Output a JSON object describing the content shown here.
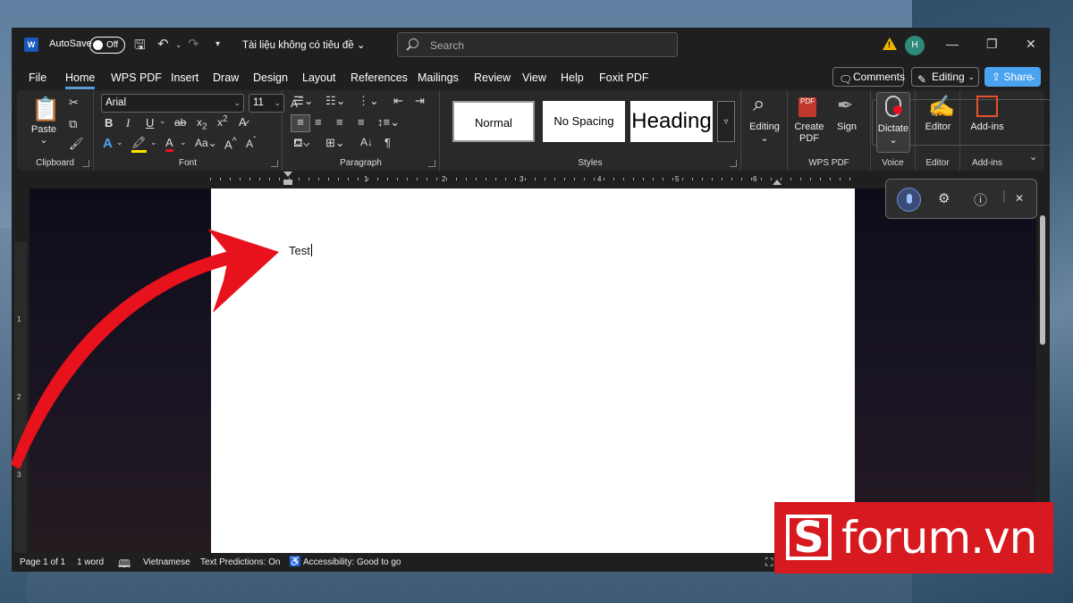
{
  "titlebar": {
    "app_badge": "W",
    "autosave_label": "AutoSave",
    "autosave_state": "Off",
    "document_title": "Tài liệu không có tiêu đề",
    "search_placeholder": "Search",
    "user_initial": "H"
  },
  "menu": {
    "tabs": [
      "File",
      "Home",
      "WPS PDF",
      "Insert",
      "Draw",
      "Design",
      "Layout",
      "References",
      "Mailings",
      "Review",
      "View",
      "Help",
      "Foxit PDF"
    ],
    "active_tab": "Home",
    "comments_label": "Comments",
    "editing_label": "Editing",
    "share_label": "Share"
  },
  "ribbon": {
    "clipboard": {
      "paste_label": "Paste",
      "group_label": "Clipboard"
    },
    "font": {
      "font_name": "Arial",
      "font_size": "11",
      "group_label": "Font"
    },
    "paragraph": {
      "group_label": "Paragraph"
    },
    "styles": {
      "items": [
        "Normal",
        "No Spacing",
        "Heading"
      ],
      "group_label": "Styles"
    },
    "editing": {
      "label": "Editing"
    },
    "wps_pdf": {
      "create_pdf_line1": "Create",
      "create_pdf_line2": "PDF",
      "sign_label": "Sign",
      "group_label": "WPS PDF",
      "pdf_badge": "PDF"
    },
    "voice": {
      "dictate_label": "Dictate",
      "group_label": "Voice"
    },
    "editor": {
      "label": "Editor",
      "group_label": "Editor"
    },
    "addins": {
      "label": "Add-ins",
      "group_label": "Add-ins"
    }
  },
  "ruler": {
    "numbers": [
      "1",
      "2",
      "3",
      "4",
      "5",
      "6"
    ],
    "vertical_numbers": [
      "1",
      "2",
      "3"
    ]
  },
  "document": {
    "body_text": "Test"
  },
  "status": {
    "page": "Page 1 of 1",
    "words": "1 word",
    "language": "Vietnamese",
    "predictions": "Text Predictions: On",
    "accessibility": "Accessibility: Good to go"
  },
  "watermark": {
    "brand_letter": "S",
    "brand_text": "forum.vn"
  },
  "colors": {
    "accent": "#5b9bd5",
    "share": "#4aa3f0",
    "arrow": "#e8121c",
    "brand": "#d71920"
  }
}
